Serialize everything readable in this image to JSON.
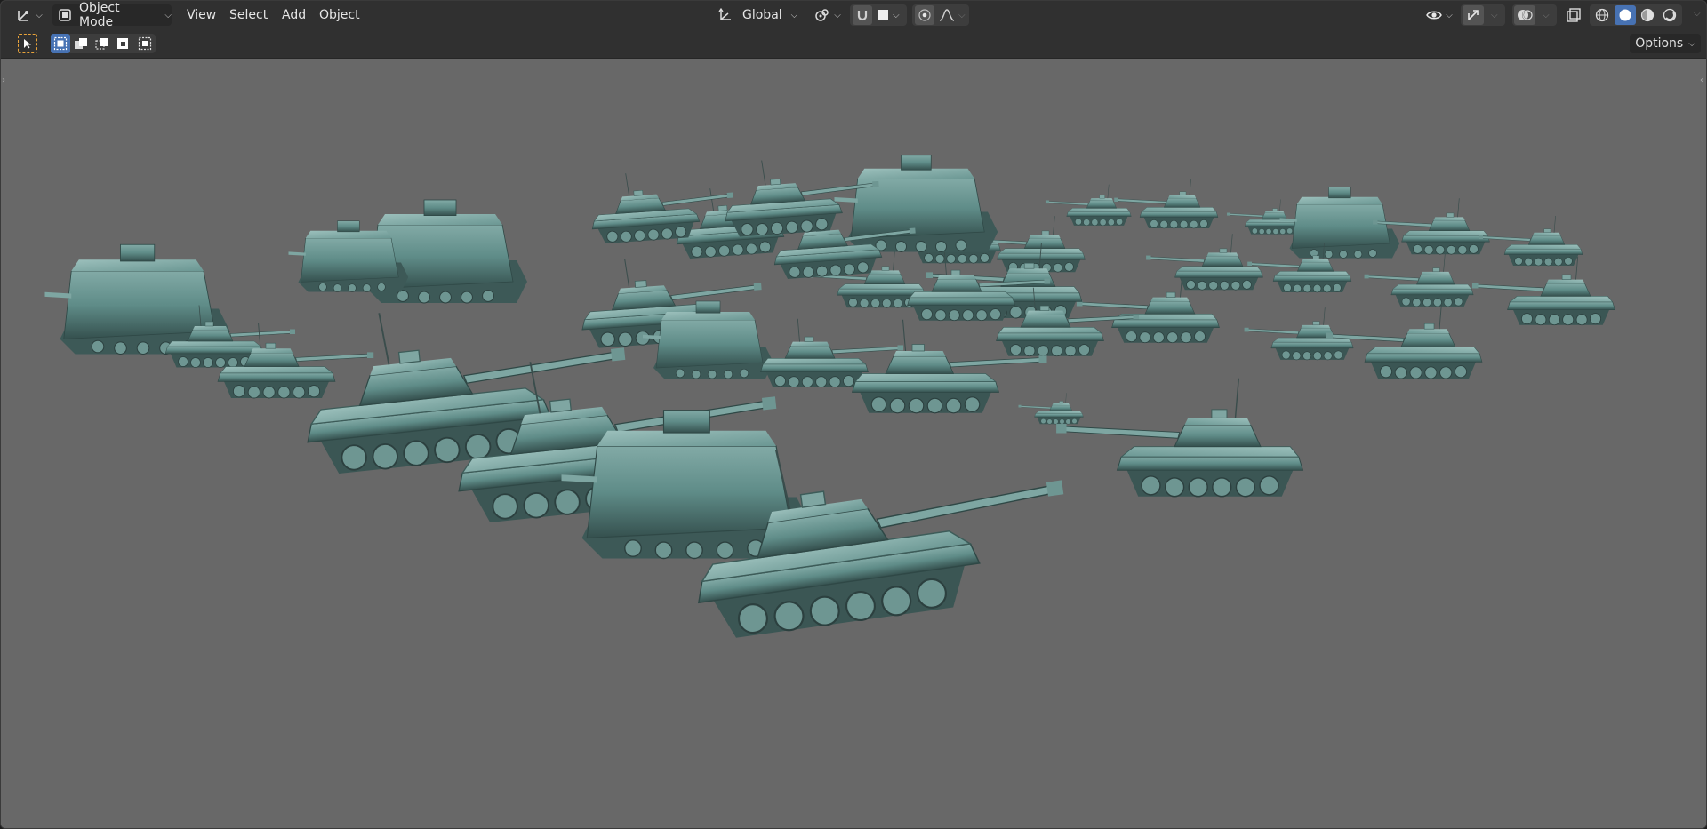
{
  "header": {
    "editor_type_icon": "axis-cursor-icon",
    "mode": {
      "icon": "object-mode-icon",
      "label": "Object Mode"
    },
    "menus": [
      "View",
      "Select",
      "Add",
      "Object"
    ],
    "transform_orientation": {
      "icon": "orientation-gizmo-icon",
      "label": "Global"
    },
    "pivot_icon": "pivot-point-icon",
    "snap_icon": "magnet-icon",
    "snap_target_icon": "square-snap-icon",
    "proportional_icon": "proportional-circle-icon",
    "falloff_icon": "falloff-curve-icon",
    "visibility_icon": "eye-icon",
    "gizmo_icon": "gizmo-arrow-icon",
    "overlay_icon": "overlay-circles-icon",
    "xray_icon": "xray-icon",
    "shading_modes": [
      {
        "name": "wireframe",
        "icon": "wireframe-sphere-icon",
        "active": false
      },
      {
        "name": "solid",
        "icon": "solid-sphere-icon",
        "active": true
      },
      {
        "name": "material",
        "icon": "material-sphere-icon",
        "active": false
      },
      {
        "name": "rendered",
        "icon": "rendered-sphere-icon",
        "active": false
      }
    ]
  },
  "toolrow": {
    "select_tool_icon": "select-cursor-icon",
    "select_modes": [
      "set-new-icon",
      "extend-icon",
      "subtract-icon",
      "invert-icon",
      "intersect-icon"
    ],
    "options_label": "Options"
  },
  "viewport": {
    "background": "#686868",
    "model_color": "#5d8a86",
    "content": "3D tank models"
  },
  "colors": {
    "header_bg": "#303030",
    "accent": "#4772b3",
    "select_tool_outline": "#e8a33a"
  }
}
